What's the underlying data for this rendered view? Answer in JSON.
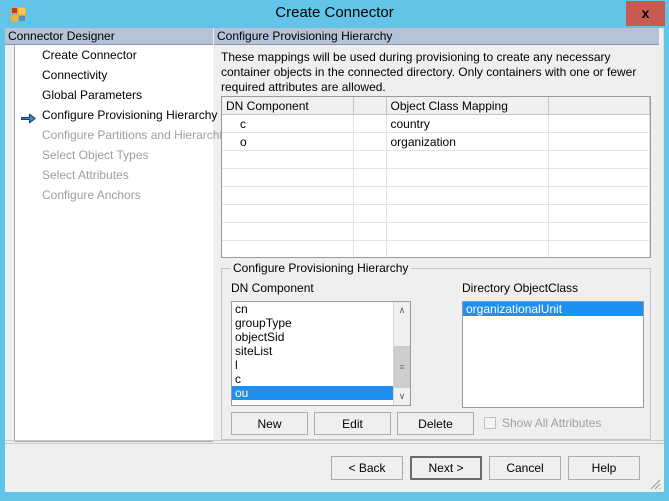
{
  "window": {
    "title": "Create Connector",
    "icon": "app-window-icon",
    "close_label": "x"
  },
  "sidebar": {
    "header": "Connector Designer",
    "items": [
      {
        "label": "Create Connector",
        "state": "done",
        "active": false
      },
      {
        "label": "Connectivity",
        "state": "done",
        "active": false
      },
      {
        "label": "Global Parameters",
        "state": "done",
        "active": false
      },
      {
        "label": "Configure Provisioning Hierarchy",
        "state": "current",
        "active": true
      },
      {
        "label": "Configure Partitions and Hierarchies",
        "state": "disabled",
        "active": false
      },
      {
        "label": "Select Object Types",
        "state": "disabled",
        "active": false
      },
      {
        "label": "Select Attributes",
        "state": "disabled",
        "active": false
      },
      {
        "label": "Configure Anchors",
        "state": "disabled",
        "active": false
      }
    ]
  },
  "main": {
    "header": "Configure Provisioning Hierarchy",
    "description": "These mappings will be used during provisioning to create any necessary container objects in the connected directory.  Only containers with one or fewer required attributes are allowed.",
    "mappings_grid": {
      "columns": [
        "DN Component",
        "",
        "Object Class Mapping",
        ""
      ],
      "rows": [
        [
          "c",
          "",
          "country",
          ""
        ],
        [
          "o",
          "",
          "organization",
          ""
        ]
      ],
      "empty_rows": 7
    },
    "groupbox": {
      "legend": "Configure Provisioning Hierarchy",
      "dn_component": {
        "label": "DN Component",
        "items": [
          {
            "label": "cn",
            "selected": false
          },
          {
            "label": "groupType",
            "selected": false
          },
          {
            "label": "objectSid",
            "selected": false
          },
          {
            "label": "siteList",
            "selected": false
          },
          {
            "label": "l",
            "selected": false
          },
          {
            "label": "c",
            "selected": false
          },
          {
            "label": "ou",
            "selected": true
          }
        ],
        "scrollbar": {
          "up_glyph": "∧",
          "down_glyph": "∨",
          "thumb_glyph": "≡"
        }
      },
      "directory_objectclass": {
        "label": "Directory ObjectClass",
        "items": [
          {
            "label": "organizationalUnit",
            "selected": true
          }
        ]
      },
      "buttons": {
        "new": "New",
        "edit": "Edit",
        "delete": "Delete"
      },
      "checkbox": {
        "label": "Show All Attributes",
        "checked": false,
        "disabled": true
      }
    }
  },
  "footer": {
    "back": "< Back",
    "next": "Next  >",
    "cancel": "Cancel",
    "help": "Help"
  },
  "colors": {
    "window_frame": "#62c4e8",
    "close_button": "#c75b51",
    "panel_header": "#b5c3d8",
    "selection": "#1e90ef",
    "face": "#efefef",
    "disabled_text": "#9e9e9e"
  }
}
